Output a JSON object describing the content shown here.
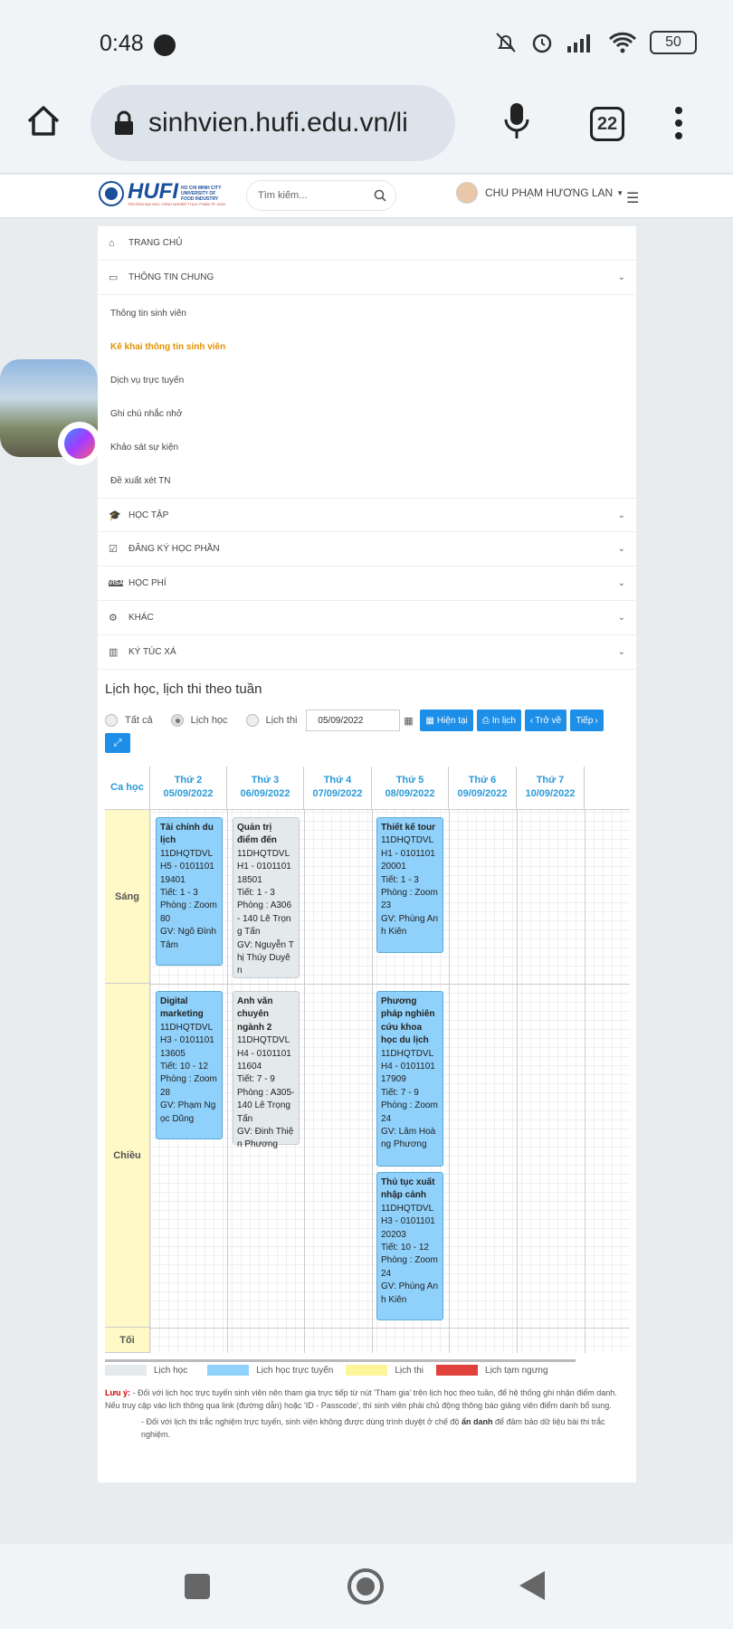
{
  "status_bar": {
    "time": "0:48",
    "battery": "50"
  },
  "browser": {
    "url": "sinhvien.hufi.edu.vn/li",
    "tab_count": "22"
  },
  "topnav": {
    "logo_text": "HUFI",
    "logo_sub1": "HO CHI MINH CITY",
    "logo_sub2": "UNIVERSITY OF",
    "logo_sub3": "FOOD INDUSTRY",
    "logo_tagline": "TRƯỜNG ĐẠI HỌC CÔNG NGHIỆP THỰC PHẨM TP. HCM",
    "search_placeholder": "Tìm kiếm...",
    "user_name": "CHU PHẠM HƯƠNG LAN"
  },
  "menu": {
    "home": "TRANG CHỦ",
    "general": "THÔNG TIN CHUNG",
    "general_items": [
      "Thông tin sinh viên",
      "Kê khai thông tin sinh viên",
      "Dịch vụ trực tuyến",
      "Ghi chú nhắc nhở",
      "Khảo sát sự kiện",
      "Đề xuất xét TN"
    ],
    "study": "HỌC TẬP",
    "register": "ĐĂNG KÝ HỌC PHẦN",
    "fee": "HỌC PHÍ",
    "other": "KHÁC",
    "dorm": "KÝ TÚC XÁ"
  },
  "schedule": {
    "title": "Lịch học, lịch thi theo tuần",
    "filter_all": "Tất cả",
    "filter_study": "Lịch học",
    "filter_exam": "Lịch thi",
    "date": "05/09/2022",
    "btn_current": "Hiện tại",
    "btn_print": "In lịch",
    "btn_back": "Trở về",
    "btn_next": "Tiếp",
    "col_session": "Ca học",
    "days": [
      {
        "name": "Thứ 2",
        "date": "05/09/2022"
      },
      {
        "name": "Thứ 3",
        "date": "06/09/2022"
      },
      {
        "name": "Thứ 4",
        "date": "07/09/2022"
      },
      {
        "name": "Thứ 5",
        "date": "08/09/2022"
      },
      {
        "name": "Thứ 6",
        "date": "09/09/2022"
      },
      {
        "name": "Thứ 7",
        "date": "10/09/2022"
      }
    ],
    "sessions": [
      "Sáng",
      "Chiều",
      "Tối"
    ],
    "classes": [
      {
        "name": "Tài chính du lịch",
        "code": "11DHQTDVLH5 - 010110119401",
        "period": "Tiết: 1 - 3",
        "room": "Phòng : Zoom80",
        "teacher": "GV: Ngô Đình Tâm"
      },
      {
        "name": "Quản trị điểm đến",
        "code": "11DHQTDVLH1 - 010110118501",
        "period": "Tiết: 1 - 3",
        "room": "Phòng : A306 - 140 Lê Trọng Tấn",
        "teacher": "GV: Nguyễn Thị Thúy Duyên"
      },
      {
        "name": "Thiết kế tour",
        "code": "11DHQTDVLH1 - 010110120001",
        "period": "Tiết: 1 - 3",
        "room": "Phòng : Zoom23",
        "teacher": "GV: Phùng Anh Kiên"
      },
      {
        "name": "Digital marketing",
        "code": "11DHQTDVLH3 - 010110113605",
        "period": "Tiết: 10 - 12",
        "room": "Phòng : Zoom28",
        "teacher": "GV: Phạm Ngọc Dũng"
      },
      {
        "name": "Anh văn chuyên ngành 2",
        "code": "11DHQTDVLH4 - 010110111604",
        "period": "Tiết: 7 - 9",
        "room": "Phòng : A305- 140 Lê Trọng Tấn",
        "teacher": "GV: Đinh Thiện Phương"
      },
      {
        "name": "Phương pháp nghiên cứu khoa học du lịch",
        "code": "11DHQTDVLH4 - 010110117909",
        "period": "Tiết: 7 - 9",
        "room": "Phòng : Zoom24",
        "teacher": "GV: Lâm Hoàng Phương"
      },
      {
        "name": "Thủ tục xuất nhập cảnh",
        "code": "11DHQTDVLH3 - 010110120203",
        "period": "Tiết: 10 - 12",
        "room": "Phòng : Zoom24",
        "teacher": "GV: Phùng Anh Kiên"
      }
    ],
    "legend": [
      "Lịch học",
      "Lịch học trực tuyến",
      "Lịch thi",
      "Lịch tạm ngưng"
    ],
    "legend_colors": [
      "#e4e9ec",
      "#90d1fb",
      "#fdf59a",
      "#e0413a"
    ],
    "note_label": "Lưu ý:",
    "note1": "- Đối với lịch học trực tuyến sinh viên nên tham gia trực tiếp từ nút 'Tham gia' trên lịch học theo tuần, để hệ thống ghi nhận điểm danh. Nếu truy cập vào lịch thông qua link (đường dẫn) hoặc 'ID - Passcode', thì sinh viên phải chủ động thông báo giảng viên điểm danh bổ sung.",
    "note2_a": "- Đối với lịch thi trắc nghiệm trực tuyến, sinh viên không được dùng trình duyệt ở chế độ",
    "note2_b": "ẩn danh",
    "note2_c": "để đảm bảo dữ liệu bài thi trắc nghiệm."
  }
}
